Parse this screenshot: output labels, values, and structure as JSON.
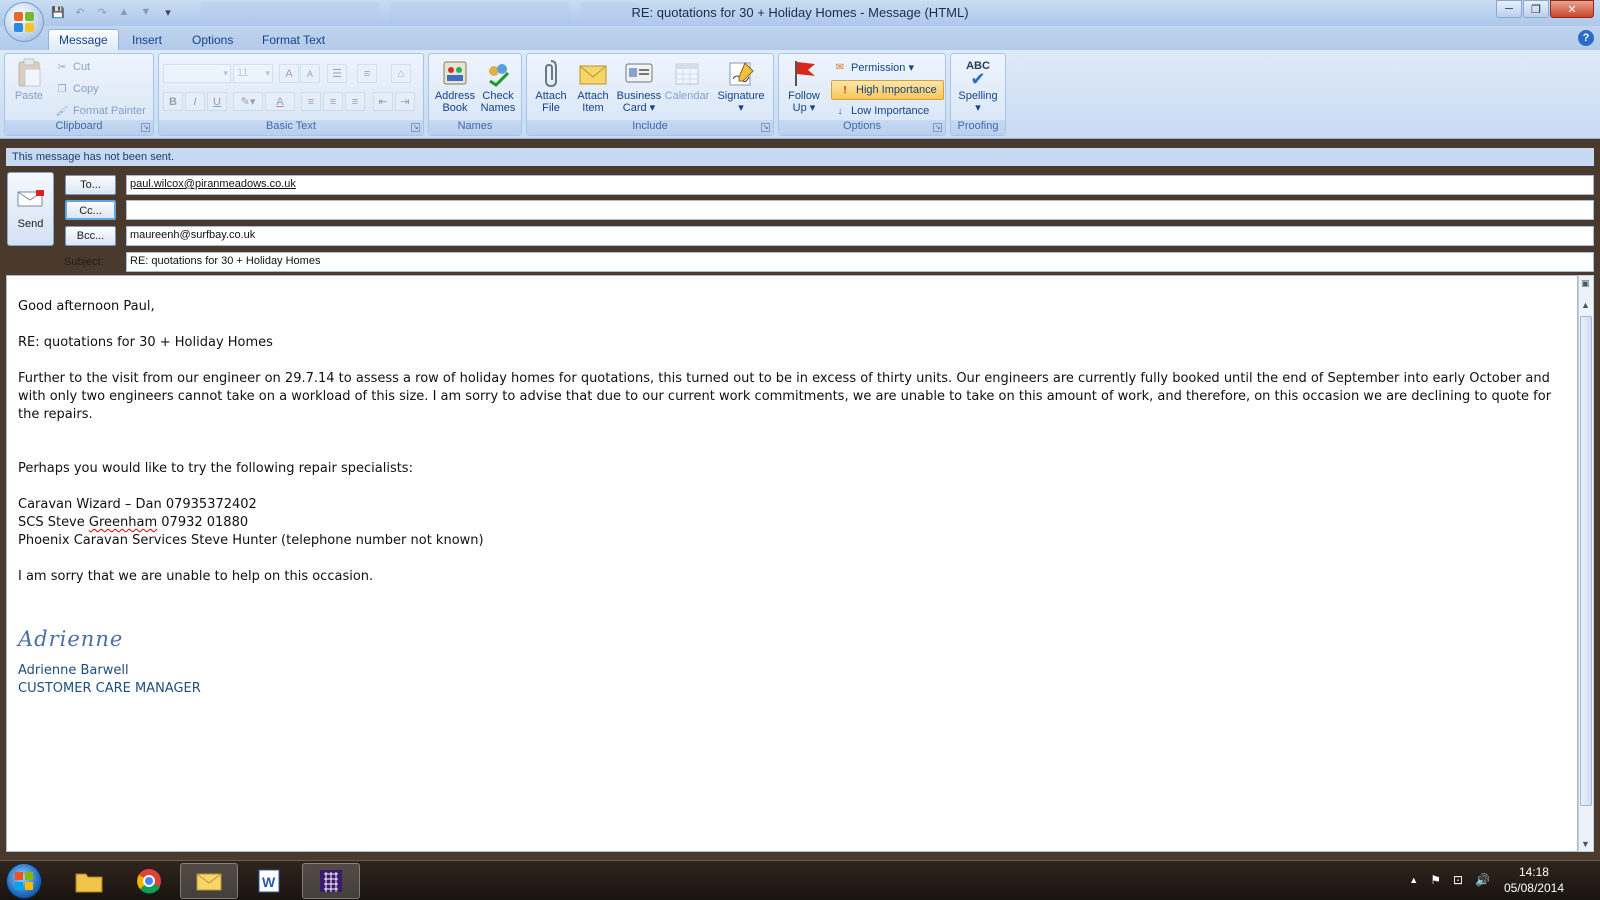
{
  "window": {
    "title": "RE: quotations for 30 + Holiday Homes - Message (HTML)",
    "controls": {
      "minimize": "─",
      "maximize": "❐",
      "close": "✕"
    }
  },
  "qat": {
    "save": "💾",
    "undo": "↶",
    "redo": "↷",
    "prev": "▲",
    "next": "▼",
    "more": "▾"
  },
  "tabs": [
    "Message",
    "Insert",
    "Options",
    "Format Text"
  ],
  "help": "?",
  "ribbon": {
    "clipboard": {
      "label": "Clipboard",
      "paste": "Paste",
      "cut": "Cut",
      "copy": "Copy",
      "format_painter": "Format Painter"
    },
    "basic_text": {
      "label": "Basic Text",
      "font_size": "11",
      "bold": "B",
      "italic": "I",
      "underline": "U",
      "grow": "A",
      "shrink": "A",
      "font_color": "A"
    },
    "names": {
      "label": "Names",
      "address_book": [
        "Address",
        "Book"
      ],
      "check_names": [
        "Check",
        "Names"
      ]
    },
    "include": {
      "label": "Include",
      "attach_file": [
        "Attach",
        "File"
      ],
      "attach_item": [
        "Attach",
        "Item"
      ],
      "business_card": [
        "Business",
        "Card ▾"
      ],
      "calendar": "Calendar",
      "signature": [
        "Signature",
        "▾"
      ]
    },
    "options": {
      "label": "Options",
      "follow_up": [
        "Follow",
        "Up ▾"
      ],
      "permission": "Permission ▾",
      "high_importance": "High Importance",
      "low_importance": "Low Importance"
    },
    "proofing": {
      "label": "Proofing",
      "spelling": "Spelling",
      "spelling_sub": "▾",
      "abc": "ABC"
    }
  },
  "info_bar": "This message has not been sent.",
  "compose": {
    "send": "Send",
    "to_label": "To...",
    "cc_label": "Cc...",
    "bcc_label": "Bcc...",
    "subject_label": "Subject:",
    "to_value": "paul.wilcox@piranmeadows.co.uk",
    "cc_value": "",
    "bcc_value": "maureenh@surfbay.co.uk",
    "subject_value": "RE: quotations for 30 + Holiday Homes"
  },
  "body": {
    "greeting": "Good afternoon Paul,",
    "re_line": "RE: quotations for 30 + Holiday Homes",
    "para1": "Further to the visit from our engineer on 29.7.14 to assess a row of  holiday homes for quotations, this turned out to be in excess of thirty units.  Our engineers are currently fully booked until the end of September into early October and with only two engineers cannot take on a workload of this size.  I am sorry to advise that due to our current work commitments, we are unable to take on this amount of work,  and therefore, on this occasion we are declining to quote for the repairs.",
    "perhaps": "Perhaps you would like to try the following repair specialists:",
    "spec1": "Caravan Wizard – Dan 07935372402",
    "spec2_pre": "SCS Steve ",
    "spec2_name": "Greenham",
    "spec2_post": " 07932 01880",
    "spec3": "Phoenix Caravan Services  Steve Hunter (telephone number not known)",
    "sorry": "I am sorry that we are unable to help on this occasion.",
    "signature": "Adrienne",
    "sig_name": "Adrienne Barwell",
    "sig_title": "CUSTOMER CARE MANAGER"
  },
  "taskbar": {
    "time": "14:18",
    "date": "05/08/2014",
    "tray": {
      "arrow": "▲",
      "flag": "⚑",
      "network": "⊡",
      "volume": "🔊"
    }
  },
  "colors": {
    "accent": "#15428b",
    "ribbon": "#dfeaf8",
    "info_bar": "#c6d9f1",
    "high_importance": "#f8c55a"
  }
}
